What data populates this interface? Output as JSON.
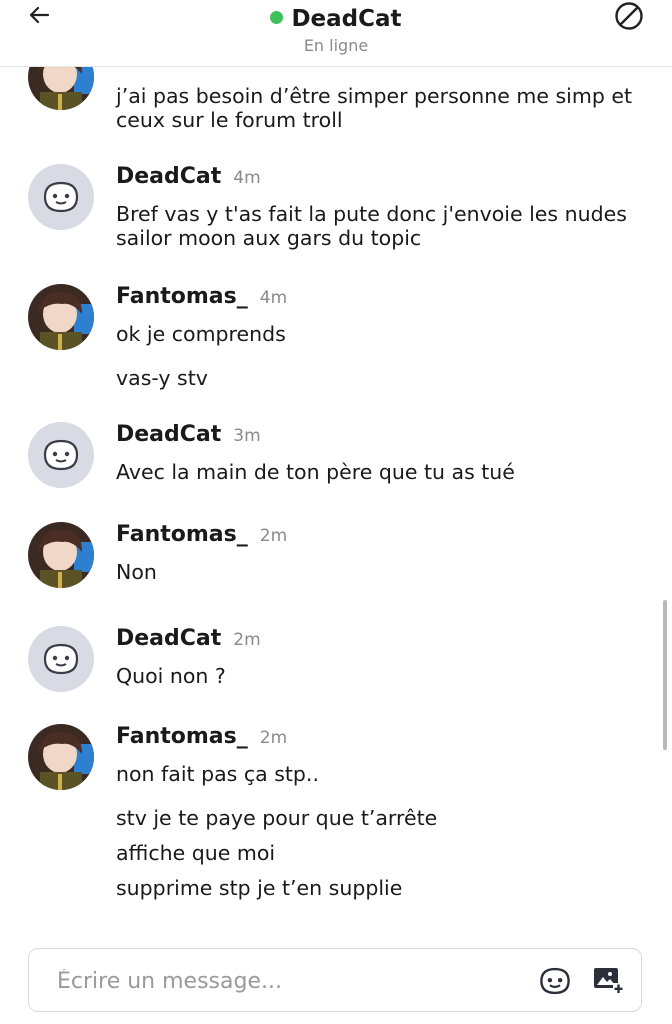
{
  "header": {
    "contact_name": "DeadCat",
    "status": "En ligne",
    "status_color": "#3ec15b",
    "back_icon": "arrow-left-icon",
    "block_icon": "block-icon"
  },
  "messages": [
    {
      "author": "",
      "time": "",
      "lines": [
        "j’ai pas besoin d’être simper personne me simp et ceux sur le forum troll"
      ]
    },
    {
      "author": "DeadCat",
      "time": "4m",
      "lines": [
        "Bref vas y t'as fait la pute donc j'envoie les nudes sailor moon aux gars du topic"
      ]
    },
    {
      "author": "Fantomas_",
      "time": "4m",
      "lines": [
        "ok je comprends",
        "vas-y stv"
      ]
    },
    {
      "author": "DeadCat",
      "time": "3m",
      "lines": [
        "Avec la main de ton père que tu as tué"
      ]
    },
    {
      "author": "Fantomas_",
      "time": "2m",
      "lines": [
        "Non"
      ]
    },
    {
      "author": "DeadCat",
      "time": "2m",
      "lines": [
        "Quoi non ?"
      ]
    },
    {
      "author": "Fantomas_",
      "time": "2m",
      "lines": [
        "non fait pas ça stp..",
        "stv je te paye pour que t’arrête",
        "affiche que moi",
        "supprime stp je t’en supplie"
      ]
    }
  ],
  "composer": {
    "placeholder": "Écrire un message...",
    "emoji_icon": "emoji-face-icon",
    "image_icon": "add-image-icon"
  }
}
